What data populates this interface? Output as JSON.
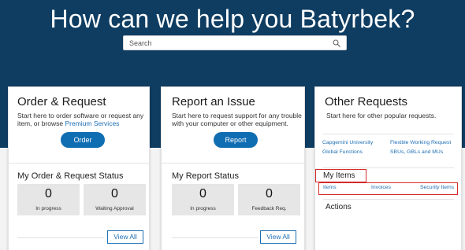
{
  "hero": {
    "title": "How can we help you Batyrbek?",
    "search_placeholder": "Search",
    "search_icon": "magnifier-icon"
  },
  "order_card": {
    "title": "Order & Request",
    "description_text": "Start here to order software or request any item, or browse ",
    "description_link": "Premium Services",
    "button": "Order",
    "status_title": "My Order & Request Status",
    "stats": [
      {
        "value": "0",
        "label": "In progress"
      },
      {
        "value": "0",
        "label": "Waiting Approval"
      }
    ],
    "view_all": "View All"
  },
  "report_card": {
    "title": "Report an Issue",
    "description_text": "Start here to request support for any trouble with your computer or other equipment.",
    "button": "Report",
    "status_title": "My Report Status",
    "stats": [
      {
        "value": "0",
        "label": "In progress"
      },
      {
        "value": "0",
        "label": "Feedback Req."
      }
    ],
    "view_all": "View All"
  },
  "other_card": {
    "title": "Other Requests",
    "description_text": "Start here for other popular requests.",
    "links": [
      "Capgemini University",
      "Flexible Working Request",
      "Global Functions",
      "SBUs, GBLs and MUs"
    ],
    "my_items_title": "My Items",
    "my_items_links": [
      "Items",
      "Invoices",
      "Security Items"
    ],
    "actions_title": "Actions"
  },
  "colors": {
    "hero_bg": "#0f3d62",
    "primary_button": "#0f6db2",
    "link": "#1f6fb5",
    "highlight_box": "#d62a2a"
  }
}
